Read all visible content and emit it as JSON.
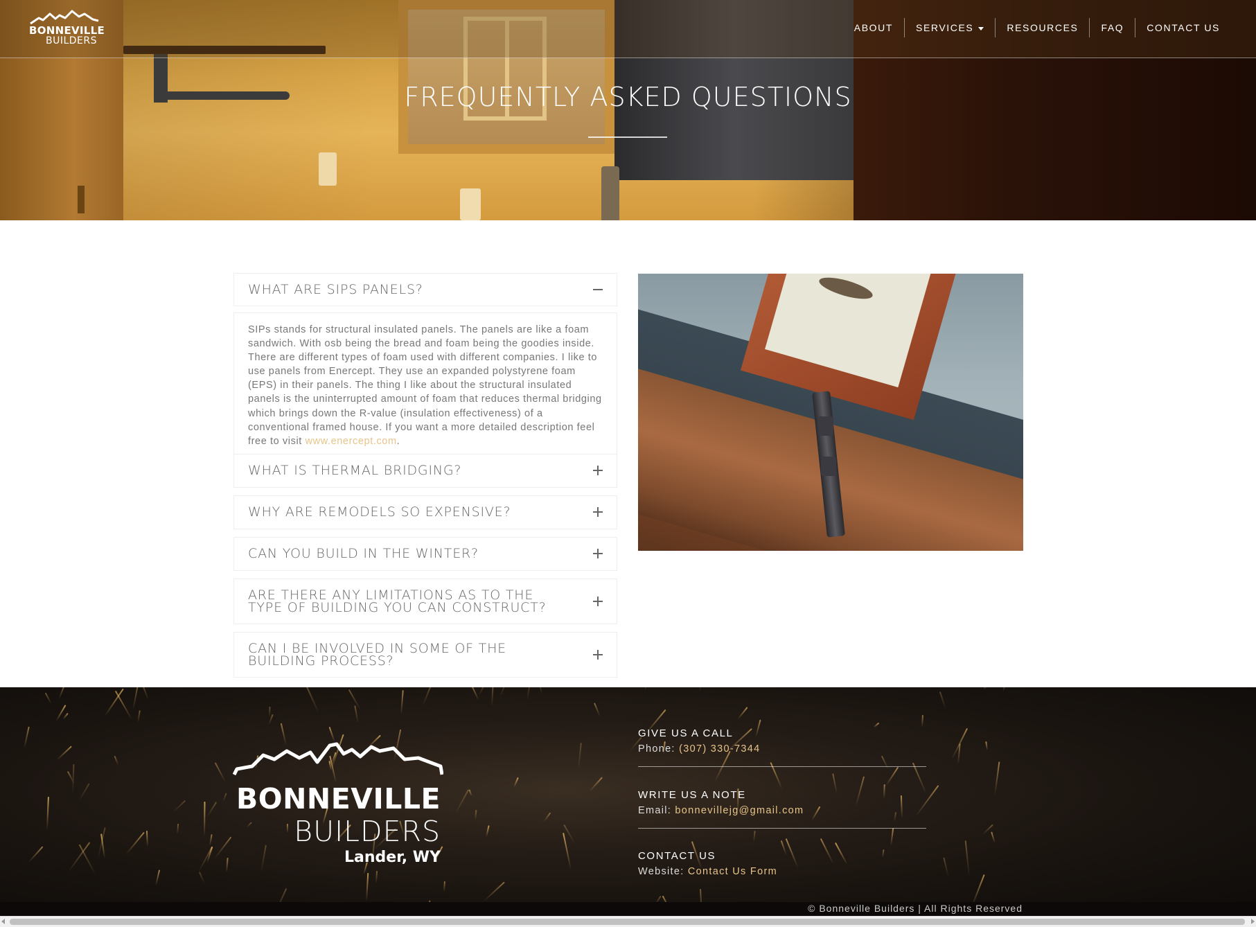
{
  "nav": {
    "logo_line1": "BONNEVILLE",
    "logo_line2": "BUILDERS",
    "items": [
      {
        "label": "ABOUT"
      },
      {
        "label": "SERVICES"
      },
      {
        "label": "RESOURCES"
      },
      {
        "label": "FAQ"
      },
      {
        "label": "CONTACT US"
      }
    ]
  },
  "hero": {
    "title": "FREQUENTLY ASKED QUESTIONS"
  },
  "faq": {
    "items": [
      {
        "question": "WHAT ARE SIPS PANELS?",
        "expanded": true,
        "toggle_icon": "minus-icon"
      },
      {
        "question": "WHAT IS THERMAL BRIDGING?",
        "expanded": false,
        "toggle_icon": "plus-icon"
      },
      {
        "question": "WHY ARE REMODELS SO EXPENSIVE?",
        "expanded": false,
        "toggle_icon": "plus-icon"
      },
      {
        "question": "CAN YOU BUILD IN THE WINTER?",
        "expanded": false,
        "toggle_icon": "plus-icon"
      },
      {
        "question": "ARE THERE ANY LIMITATIONS AS TO THE TYPE OF BUILDING YOU CAN CONSTRUCT?",
        "expanded": false,
        "toggle_icon": "plus-icon"
      },
      {
        "question": "CAN I BE INVOLVED IN SOME OF THE BUILDING PROCESS?",
        "expanded": false,
        "toggle_icon": "plus-icon"
      }
    ],
    "answer_text": "SIPs stands for structural insulated panels. The panels are like a foam sandwich. With osb being the bread and foam being the goodies inside. There are different types of foam used with different companies. I like to use panels from Enercept. They use an expanded polystyrene foam (EPS) in their panels. The thing I like about the structural insulated panels is the uninterrupted amount of foam that reduces thermal bridging which brings down the R-value (insulation effectiveness) of a conventional framed house. If you want a more detailed description feel free to visit ",
    "answer_link": "www.enercept.com",
    "answer_tail": "."
  },
  "footer": {
    "logo_line1": "BONNEVILLE",
    "logo_line2": "BUILDERS",
    "location": "Lander, WY",
    "call": {
      "title": "GIVE US A CALL",
      "label": "Phone: ",
      "value": "(307) 330-7344"
    },
    "note": {
      "title": "WRITE US A NOTE",
      "label": "Email: ",
      "value": "bonnevillejg@gmail.com"
    },
    "contact": {
      "title": "CONTACT US",
      "label": "Website: ",
      "value": "Contact Us Form"
    },
    "copyright": "© Bonneville Builders | All Rights Reserved"
  },
  "colors": {
    "accent_link": "#e8c48a",
    "footer_bg": "#17120e"
  }
}
